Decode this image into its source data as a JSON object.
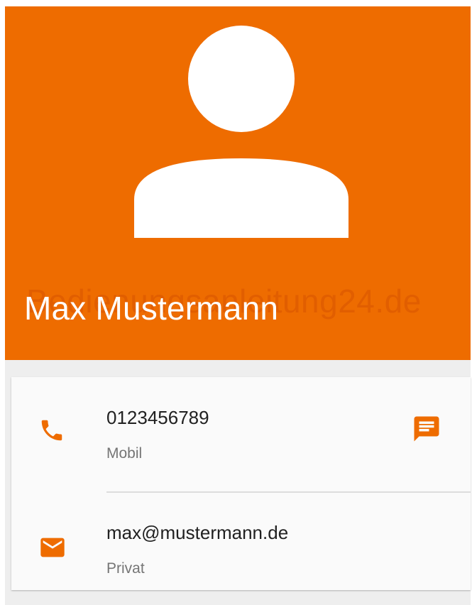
{
  "contact": {
    "name": "Max Mustermann"
  },
  "watermark": "Bedienungsanleitung24.de",
  "details": {
    "phone": {
      "number": "0123456789",
      "type": "Mobil",
      "icon": "phone-icon",
      "action_icon": "message-icon"
    },
    "email": {
      "address": "max@mustermann.de",
      "type": "Privat",
      "icon": "email-icon"
    }
  },
  "colors": {
    "accent": "#ee6c00",
    "header_bg": "#ee6c00",
    "card_bg": "#fafafa",
    "primary_text": "#212121",
    "secondary_text": "#757575"
  }
}
